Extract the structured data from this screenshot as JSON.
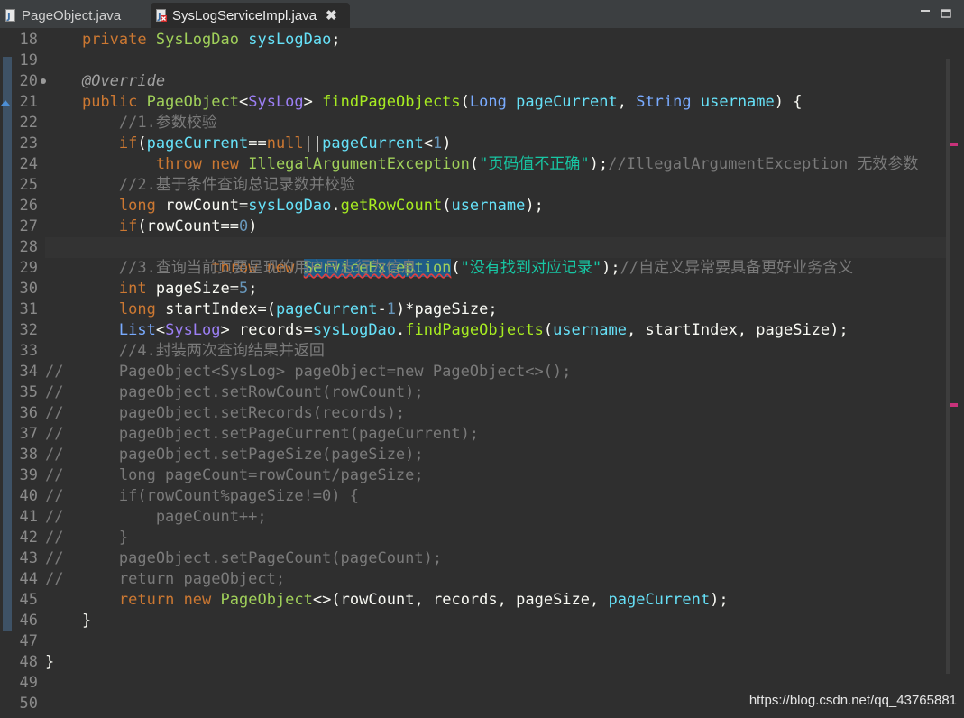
{
  "tabs": [
    {
      "label": "PageObject.java",
      "active": false
    },
    {
      "label": "SysLogServiceImpl.java",
      "active": true,
      "close": "✖"
    }
  ],
  "window_controls": {
    "minimize": "minimize-icon",
    "maximize": "maximize-icon"
  },
  "line_numbers": [
    "18",
    "19",
    "20",
    "21",
    "22",
    "23",
    "24",
    "25",
    "26",
    "27",
    "28",
    "29",
    "30",
    "31",
    "32",
    "33",
    "34",
    "35",
    "36",
    "37",
    "38",
    "39",
    "40",
    "41",
    "42",
    "43",
    "44",
    "45",
    "46",
    "47",
    "48",
    "49",
    "50"
  ],
  "code": {
    "l18": [
      "    ",
      "private",
      " ",
      "SysLogDao",
      " ",
      "sysLogDao",
      ";"
    ],
    "l20": [
      "    ",
      "@Override"
    ],
    "l21": [
      "    ",
      "public",
      " ",
      "PageObject",
      "<",
      "SysLog",
      "> ",
      "findPageObjects",
      "(",
      "Long",
      " ",
      "pageCurrent",
      ", ",
      "String",
      " ",
      "username",
      ") {"
    ],
    "l22": [
      "        ",
      "//1.参数校验"
    ],
    "l23": [
      "        ",
      "if",
      "(",
      "pageCurrent",
      "==",
      "null",
      "||",
      "pageCurrent",
      "<",
      "1",
      ")"
    ],
    "l24": [
      "            ",
      "throw",
      " ",
      "new",
      " ",
      "IllegalArgumentException",
      "(",
      "\"页码值不正确\"",
      ");",
      "//IllegalArgumentException 无效参数"
    ],
    "l25": [
      "        ",
      "//2.基于条件查询总记录数并校验"
    ],
    "l26": [
      "        ",
      "long",
      " ",
      "rowCount",
      "=",
      "sysLogDao",
      ".",
      "getRowCount",
      "(",
      "username",
      ");"
    ],
    "l27": [
      "        ",
      "if",
      "(",
      "rowCount",
      "==",
      "0",
      ")"
    ],
    "l28": [
      "            ",
      "throw",
      " ",
      "new",
      " ",
      "ServiceException",
      "(",
      "\"没有找到对应记录\"",
      ");",
      "//自定义异常要具备更好业务含义"
    ],
    "l29": [
      "        ",
      "//3.查询当前页要呈现的用户日志行为信息"
    ],
    "l30": [
      "        ",
      "int",
      " ",
      "pageSize",
      "=",
      "5",
      ";"
    ],
    "l31": [
      "        ",
      "long",
      " ",
      "startIndex",
      "=(",
      "pageCurrent",
      "-",
      "1",
      ")*",
      "pageSize",
      ";"
    ],
    "l32": [
      "        ",
      "List",
      "<",
      "SysLog",
      "> ",
      "records",
      "=",
      "sysLogDao",
      ".",
      "findPageObjects",
      "(",
      "username",
      ", ",
      "startIndex",
      ", ",
      "pageSize",
      ");"
    ],
    "l33": [
      "        ",
      "//4.封装两次查询结果并返回"
    ],
    "l34": "//      PageObject<SysLog> pageObject=new PageObject<>();",
    "l35": "//      pageObject.setRowCount(rowCount);",
    "l36": "//      pageObject.setRecords(records);",
    "l37": "//      pageObject.setPageCurrent(pageCurrent);",
    "l38": "//      pageObject.setPageSize(pageSize);",
    "l39": "//      long pageCount=rowCount/pageSize;",
    "l40": "//      if(rowCount%pageSize!=0) {",
    "l41": "//          pageCount++;",
    "l42": "//      }",
    "l43": "//      pageObject.setPageCount(pageCount);",
    "l44": "//      return pageObject;",
    "l45": [
      "        ",
      "return",
      " ",
      "new",
      " ",
      "PageObject",
      "<>(",
      "rowCount",
      ", ",
      "records",
      ", ",
      "pageSize",
      ", ",
      "pageCurrent",
      ");"
    ],
    "l46": "    }",
    "l48": "}"
  },
  "watermark": "https://blog.csdn.net/qq_43765881",
  "colors": {
    "background": "#2f2f2f",
    "keyword": "#cc7832",
    "string": "#17c6a3",
    "comment": "#7a7a7a",
    "method": "#a7ec21",
    "type": "#9c7ff4",
    "error_marker": "#c8327a"
  }
}
